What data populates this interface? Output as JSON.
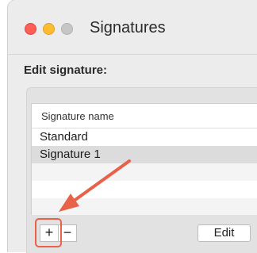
{
  "window": {
    "title": "Signatures"
  },
  "section": {
    "label": "Edit signature:"
  },
  "list": {
    "column_header": "Signature name",
    "rows": [
      {
        "label": "Standard",
        "selected": false
      },
      {
        "label": "Signature 1",
        "selected": true
      }
    ]
  },
  "buttons": {
    "add": "+",
    "remove": "−",
    "edit": "Edit"
  },
  "colors": {
    "annotation": "#e8624a",
    "traffic_close": "#fe5f57",
    "traffic_min": "#febc2e",
    "traffic_zoom": "#c6c6c6",
    "selected_row": "#dcdcdc"
  }
}
